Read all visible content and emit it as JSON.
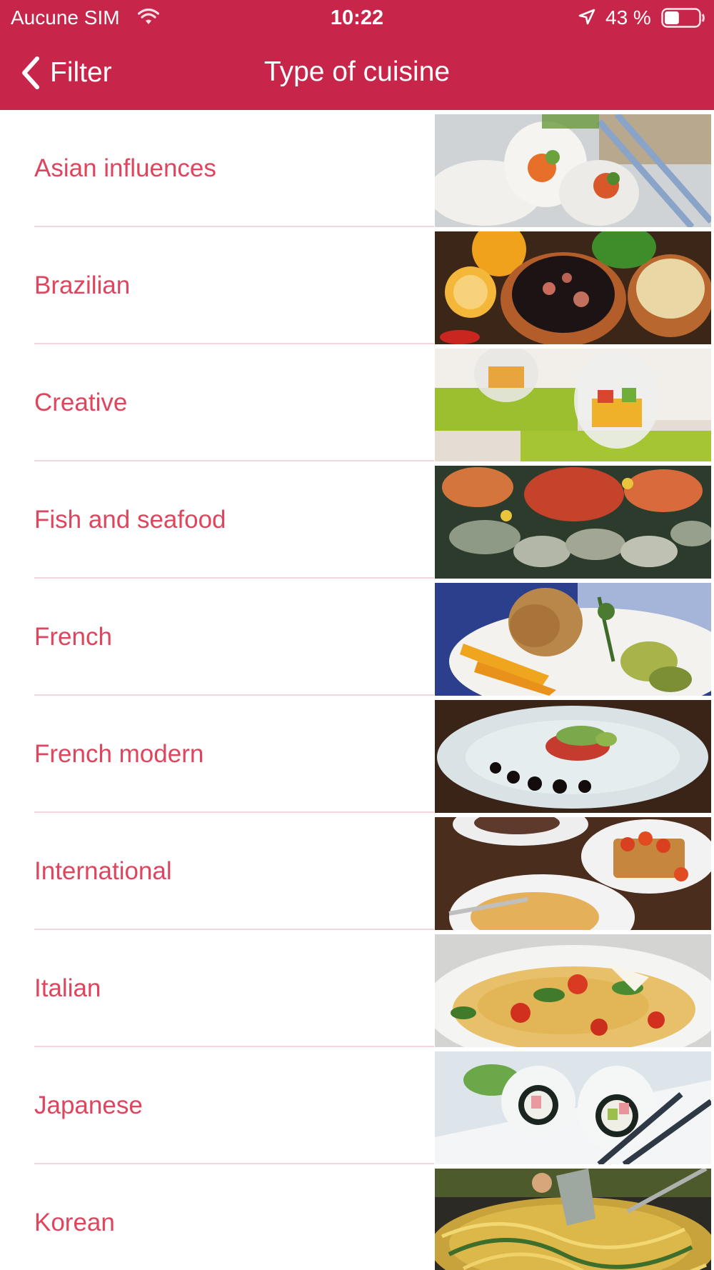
{
  "status_bar": {
    "carrier": "Aucune SIM",
    "time": "10:22",
    "battery": "43 %",
    "battery_level": 0.43,
    "icons": [
      "wifi-icon",
      "location-arrow-icon",
      "battery-icon"
    ]
  },
  "nav": {
    "back_label": "Filter",
    "title": "Type of cuisine",
    "icon": "chevron-left-icon"
  },
  "colors": {
    "bar": "#c8254a",
    "label": "#e0455e",
    "divider": "#f3d7de"
  },
  "cuisines": [
    {
      "label": "Asian influences",
      "image": "spring-rolls-photo"
    },
    {
      "label": "Brazilian",
      "image": "feijoada-photo"
    },
    {
      "label": "Creative",
      "image": "verrine-photo"
    },
    {
      "label": "Fish and seafood",
      "image": "seafood-platter-photo"
    },
    {
      "label": "French",
      "image": "lamb-shank-photo"
    },
    {
      "label": "French modern",
      "image": "plated-dish-photo"
    },
    {
      "label": "International",
      "image": "steak-bruschetta-pasta-photo"
    },
    {
      "label": "Italian",
      "image": "spaghetti-photo"
    },
    {
      "label": "Japanese",
      "image": "sushi-rolls-photo"
    },
    {
      "label": "Korean",
      "image": "grilled-noodles-photo"
    }
  ]
}
